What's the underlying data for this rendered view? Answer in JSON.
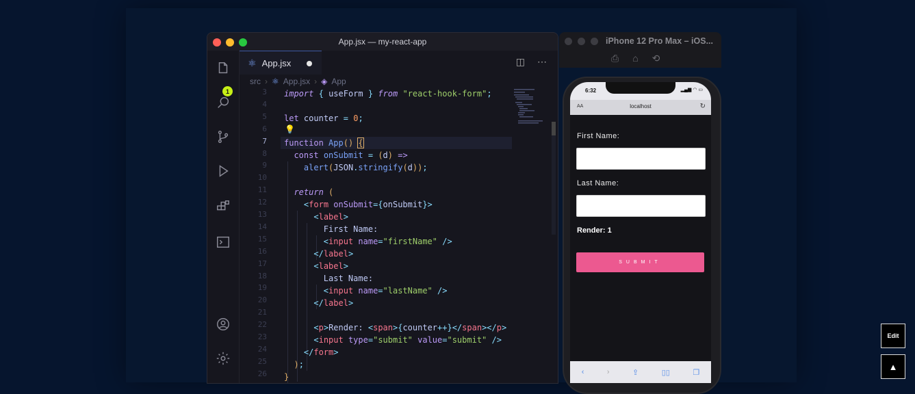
{
  "window": {
    "vscode_title": "App.jsx — my-react-app",
    "simulator_title": "iPhone 12 Pro Max – iOS..."
  },
  "activity_bar": {
    "explorer_badge": "1",
    "icons": [
      "files-icon",
      "search-icon",
      "source-control-icon",
      "run-debug-icon",
      "extensions-icon",
      "terminal-icon",
      "account-icon",
      "settings-gear-icon"
    ]
  },
  "tab": {
    "label": "App.jsx",
    "modified": true
  },
  "breadcrumb": {
    "folder": "src",
    "file": "App.jsx",
    "symbol": "App"
  },
  "editor": {
    "active_line": "7",
    "line_numbers": [
      "3",
      "4",
      "5",
      "6",
      "7",
      "8",
      "9",
      "10",
      "11",
      "12",
      "13",
      "14",
      "15",
      "16",
      "17",
      "18",
      "19",
      "20",
      "21",
      "22",
      "23",
      "24",
      "25",
      "26"
    ]
  },
  "phone": {
    "time": "6:32",
    "url_aa": "AA",
    "url": "localhost",
    "first_name_label": "First Name:",
    "last_name_label": "Last Name:",
    "render_text": "Render: 1",
    "submit_label": "SUBMIT"
  },
  "page_buttons": {
    "edit_label": "Edit",
    "up_icon": "▲"
  },
  "colors": {
    "accent_pink": "#ec5990",
    "badge_lime": "#c7f017",
    "editor_bg": "#16161e"
  }
}
